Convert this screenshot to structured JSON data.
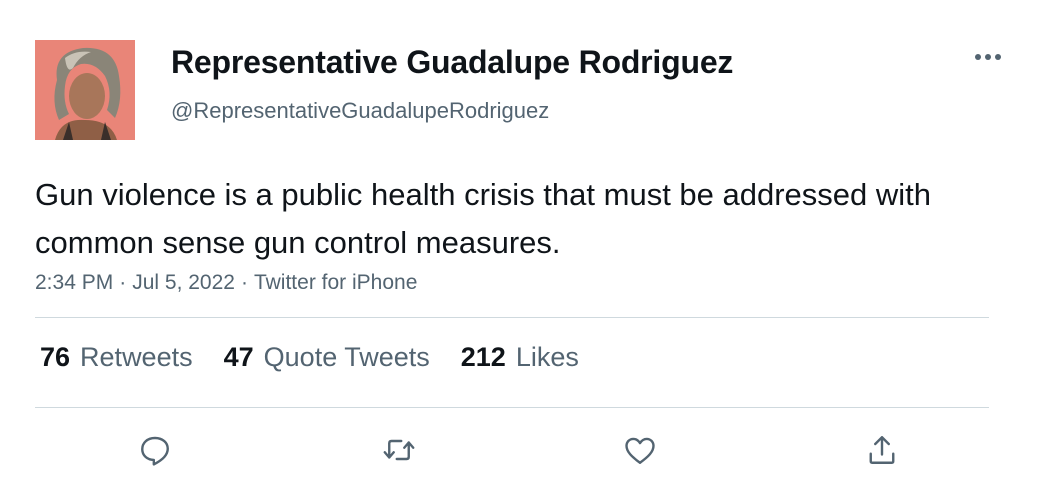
{
  "author": {
    "name": "Representative Guadalupe Rodriguez",
    "handle": "@RepresentativeGuadalupeRodriguez"
  },
  "tweet": {
    "text": "Gun violence is a public health crisis that must be addressed with common sense gun control measures.",
    "time": "2:34 PM",
    "date": "Jul 5, 2022",
    "source": "Twitter for iPhone"
  },
  "stats": {
    "retweets": {
      "count": "76",
      "label": "Retweets"
    },
    "quotes": {
      "count": "47",
      "label": "Quote Tweets"
    },
    "likes": {
      "count": "212",
      "label": "Likes"
    }
  },
  "icons": {
    "more": "more-dots-icon",
    "reply": "reply-bubble-icon",
    "retweet": "retweet-icon",
    "like": "heart-icon",
    "share": "share-upload-icon"
  },
  "colors": {
    "text_primary": "#0f1419",
    "text_secondary": "#536471",
    "divider": "#cfd9de",
    "avatar_bg": "#e98578"
  }
}
